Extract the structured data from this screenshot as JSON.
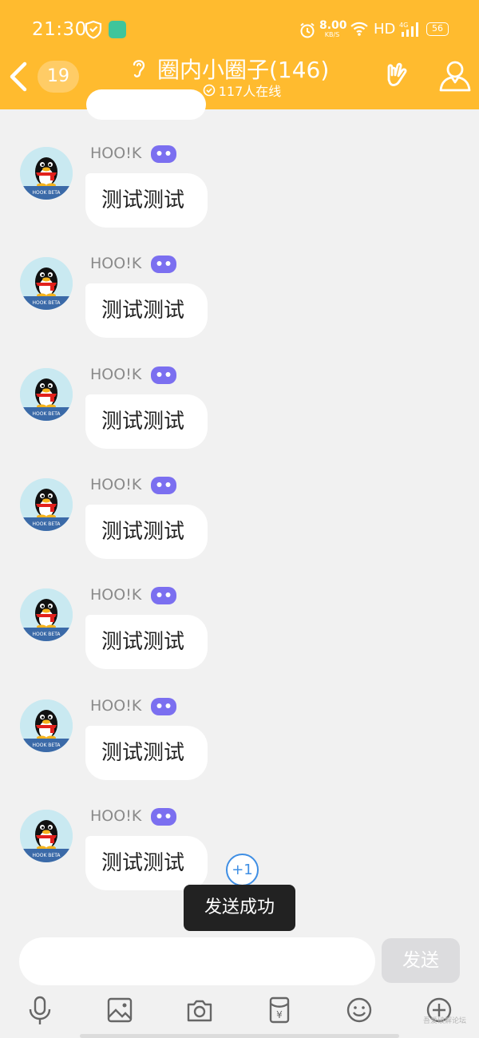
{
  "status_bar": {
    "time": "21:30",
    "net_speed": "8.00",
    "net_speed_unit": "KB/S",
    "hd": "HD",
    "network": "4G",
    "battery": "56"
  },
  "header": {
    "unread_count": "19",
    "title": "圈内小圈子(146)",
    "online_text": "117人在线"
  },
  "messages": [
    {
      "sender": "HOO!K",
      "text": "测试测试"
    },
    {
      "sender": "HOO!K",
      "text": "测试测试"
    },
    {
      "sender": "HOO!K",
      "text": "测试测试"
    },
    {
      "sender": "HOO!K",
      "text": "测试测试"
    },
    {
      "sender": "HOO!K",
      "text": "测试测试"
    },
    {
      "sender": "HOO!K",
      "text": "测试测试"
    },
    {
      "sender": "HOO!K",
      "text": "测试测试"
    }
  ],
  "avatar_caption": "HOOK BETA",
  "plus_one": "+1",
  "toast": "发送成功",
  "input": {
    "value": "",
    "placeholder": ""
  },
  "send_label": "发送",
  "toolbar_icons": [
    "microphone-icon",
    "image-icon",
    "camera-icon",
    "red-packet-icon",
    "emoji-icon",
    "plus-icon"
  ],
  "watermark": "吾爱破解论坛",
  "colors": {
    "header": "#ffbb2f",
    "robot_badge": "#7b6ff0",
    "plus_one": "#3e8ee4",
    "toast_bg": "#222222"
  }
}
